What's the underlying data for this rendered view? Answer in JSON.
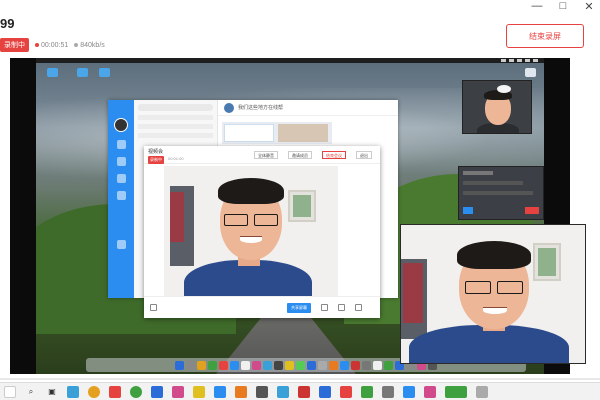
{
  "window": {
    "title": "99",
    "controls": {
      "minimize": "—",
      "maximize": "□",
      "close": "✕"
    }
  },
  "recording": {
    "badge": "录制中",
    "elapsed": "00:00:51",
    "bitrate": "840kb/s",
    "stop_label": "结束录屏"
  },
  "chat": {
    "header": "我们这些地方在线帮"
  },
  "meeting": {
    "title": "视频会",
    "badge": "录制中",
    "time": "00:01:00",
    "buttons": [
      "全体静音",
      "邀请成员",
      "结束会议",
      "退出"
    ],
    "share_label": "共享屏幕",
    "bottom_items": [
      "屏幕共享",
      "视频",
      "参会成员",
      "聊天"
    ]
  },
  "panel": {
    "title": "音频选项",
    "confirm": "确定",
    "cancel": "取消"
  },
  "colors": {
    "accent_red": "#e64340",
    "accent_blue": "#2b8df0"
  },
  "icons": {
    "desktop": [
      "folder-icon",
      "folder-icon",
      "folder-icon",
      "file-icon"
    ],
    "taskbar": [
      "start-icon",
      "search-icon",
      "task-view-icon",
      "browser-icon",
      "chrome-icon",
      "folder-icon",
      "edge-icon",
      "app-icon",
      "app-icon",
      "app-icon",
      "app-icon",
      "app-icon",
      "app-icon",
      "app-icon",
      "app-icon",
      "app-icon",
      "app-icon",
      "app-icon",
      "app-icon",
      "app-icon",
      "app-icon",
      "app-icon",
      "app-icon"
    ]
  }
}
